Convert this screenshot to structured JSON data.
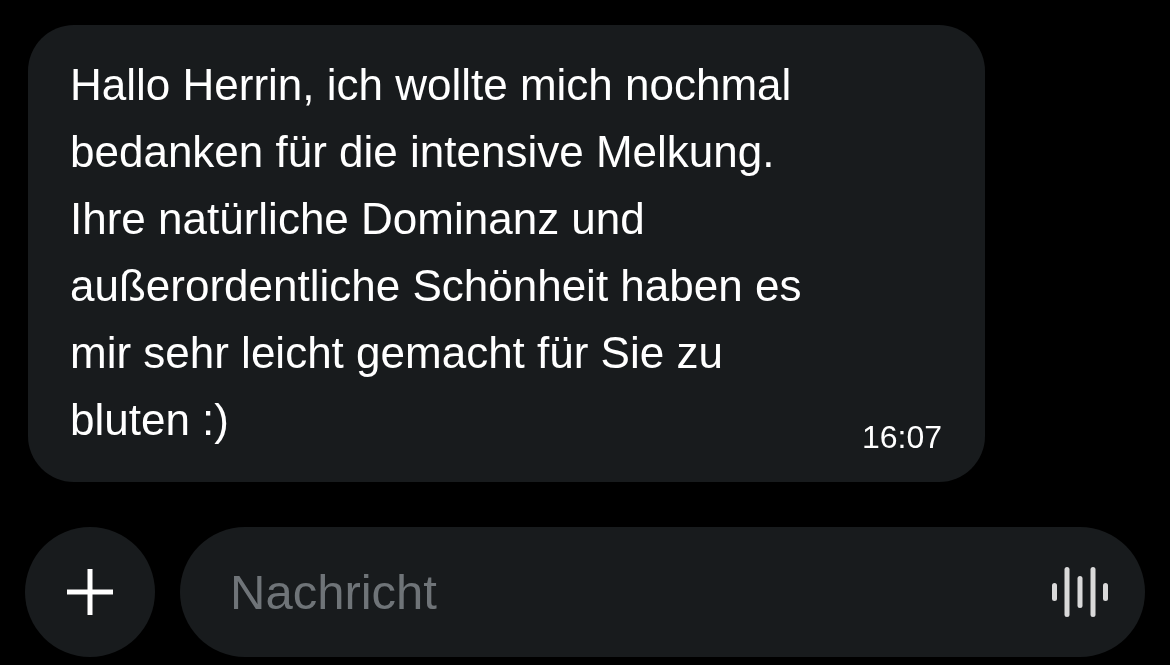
{
  "message": {
    "text": "Hallo Herrin, ich wollte mich nochmal bedanken für die intensive Melkung. Ihre natürliche Dominanz und außerordentliche Schönheit haben es mir sehr leicht gemacht für Sie zu bluten :)",
    "time": "16:07"
  },
  "composer": {
    "placeholder": "Nachricht"
  }
}
